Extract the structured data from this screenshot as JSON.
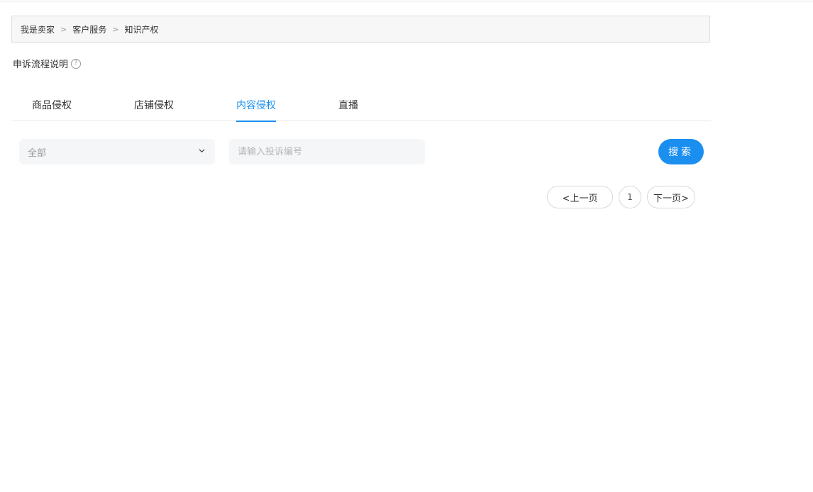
{
  "breadcrumb": {
    "items": [
      "我是卖家",
      "客户服务",
      "知识产权"
    ],
    "separator": ">"
  },
  "appeal": {
    "label": "申诉流程说明",
    "help_glyph": "?"
  },
  "tabs": [
    {
      "label": "商品侵权",
      "active": false
    },
    {
      "label": "店铺侵权",
      "active": false
    },
    {
      "label": "内容侵权",
      "active": true
    },
    {
      "label": "直播",
      "active": false
    }
  ],
  "filter": {
    "select_value": "全部",
    "search_placeholder": "请输入投诉编号",
    "search_button": "搜索"
  },
  "pagination": {
    "prev_label": "<上一页",
    "current_page": "1",
    "next_label": "下一页>"
  },
  "colors": {
    "accent": "#1b8ff0",
    "field_bg": "#f5f6f8",
    "breadcrumb_bg": "#f7f7f7"
  }
}
